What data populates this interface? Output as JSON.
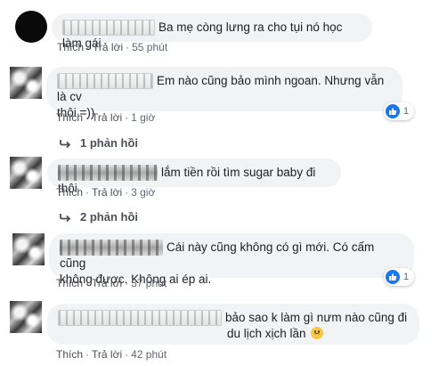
{
  "colors": {
    "bubble_bg": "#f2f3f5",
    "like_blue": "#1877f2",
    "action_text": "#606770"
  },
  "icons": {
    "like": "thumbs-up-icon",
    "reply": "reply-arrow-icon",
    "emoji": "sad-face-emoji-icon"
  },
  "comments": [
    {
      "text": "Ba mẹ còng lưng ra cho tụi nó học làm gái",
      "like": "Thích",
      "reply": "Trả lời",
      "sep": "·",
      "time": "55 phút"
    },
    {
      "text_line1": "Em nào cũng bảo mình ngoan. Nhưng vẫn là cv",
      "text_line2": "thôi =))",
      "like": "Thích",
      "reply": "Trả lời",
      "sep": "·",
      "time": "1 giờ",
      "reaction_count": "1",
      "replies_label": "1 phản hồi"
    },
    {
      "text": "lắm tiền rồi tìm sugar baby đi thôi",
      "like": "Thích",
      "reply": "Trả lời",
      "sep": "·",
      "time": "3 giờ",
      "replies_label": "2 phản hồi"
    },
    {
      "text_line1": "Cái này cũng không có gì mới. Có cấm cũng",
      "text_line2": "không được. Không ai ép ai.",
      "like": "Thích",
      "reply": "Trả lời",
      "sep": "·",
      "time": "37 phút",
      "reaction_count": "1"
    },
    {
      "text_line1": "bảo sao k làm gì nưm nào cũng đi",
      "text_line2": "du lịch xịch lần",
      "like": "Thích",
      "reply": "Trả lời",
      "sep": "·",
      "time": "42 phút"
    }
  ]
}
